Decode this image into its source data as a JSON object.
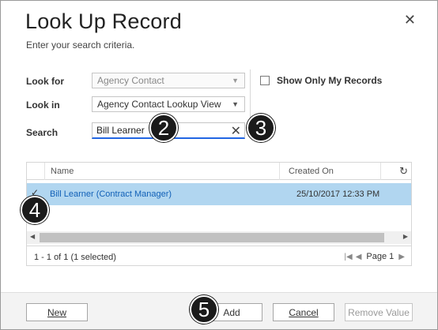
{
  "dialog": {
    "title": "Look Up Record",
    "subtitle": "Enter your search criteria.",
    "close_icon": "close-icon"
  },
  "form": {
    "look_for_label": "Look for",
    "look_for_value": "Agency Contact",
    "look_in_label": "Look in",
    "look_in_value": "Agency Contact Lookup View",
    "search_label": "Search",
    "search_value": "Bill Learner",
    "show_only_my_records_label": "Show Only My Records",
    "show_only_my_records_checked": false
  },
  "grid": {
    "columns": [
      "Name",
      "Created On"
    ],
    "rows": [
      {
        "selected": true,
        "name": "Bill Learner (Contract Manager)",
        "created_on": "25/10/2017 12:33 PM"
      }
    ],
    "record_count": "1 - 1 of 1 (1 selected)",
    "page_label": "Page 1"
  },
  "annotations": [
    "2",
    "3",
    "4",
    "5"
  ],
  "buttons": {
    "new": "New",
    "add": "Add",
    "cancel": "Cancel",
    "remove_value": "Remove Value"
  },
  "colors": {
    "selected_row": "#b1d6f0",
    "link": "#1160b7",
    "focus": "#2266e3"
  }
}
